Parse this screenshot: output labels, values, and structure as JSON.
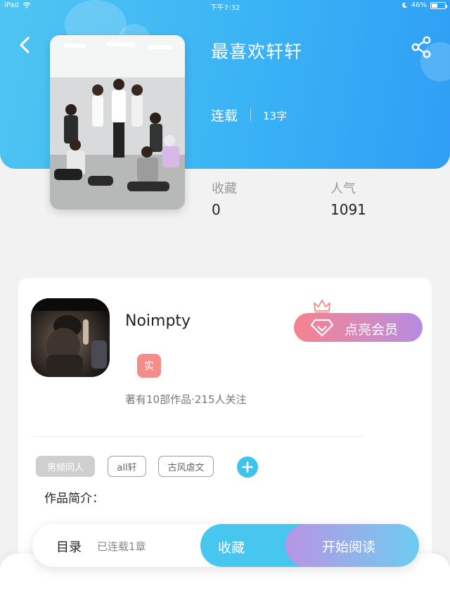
{
  "status_bar": {
    "device": "iPad",
    "time": "下午7:32",
    "battery": "46%",
    "battery_level": 0.46
  },
  "header": {
    "back_icon": "chevron-left-icon",
    "share_icon": "share-icon",
    "book_title": "最喜欢轩轩",
    "book_status": "连载",
    "word_count": "13字"
  },
  "stats": [
    {
      "label": "收藏",
      "value": "0"
    },
    {
      "label": "人气",
      "value": "1091"
    }
  ],
  "author": {
    "name": "Noimpty",
    "badge": "实",
    "meta": "著有10部作品·215人关注"
  },
  "vip_button": {
    "label": "点亮会员",
    "crown_icon": "crown-icon",
    "gem_icon": "diamond-icon"
  },
  "tags": [
    {
      "label": "男频同人",
      "style": "filled"
    },
    {
      "label": "all轩",
      "style": "outline"
    },
    {
      "label": "古风虐文",
      "style": "outline"
    }
  ],
  "add_tag_icon": "plus-icon",
  "intro_label": "作品简介：",
  "action_bar": {
    "toc_label": "目录",
    "chapter_count": "已连载1章",
    "collect_label": "收藏",
    "read_label": "开始阅读"
  },
  "colors": {
    "header_blue": "#3ab3f5",
    "accent_cyan": "#47c6ef",
    "badge_red": "#f58c8c",
    "vip_pink": "#f6818f",
    "vip_purple": "#b58be3"
  }
}
